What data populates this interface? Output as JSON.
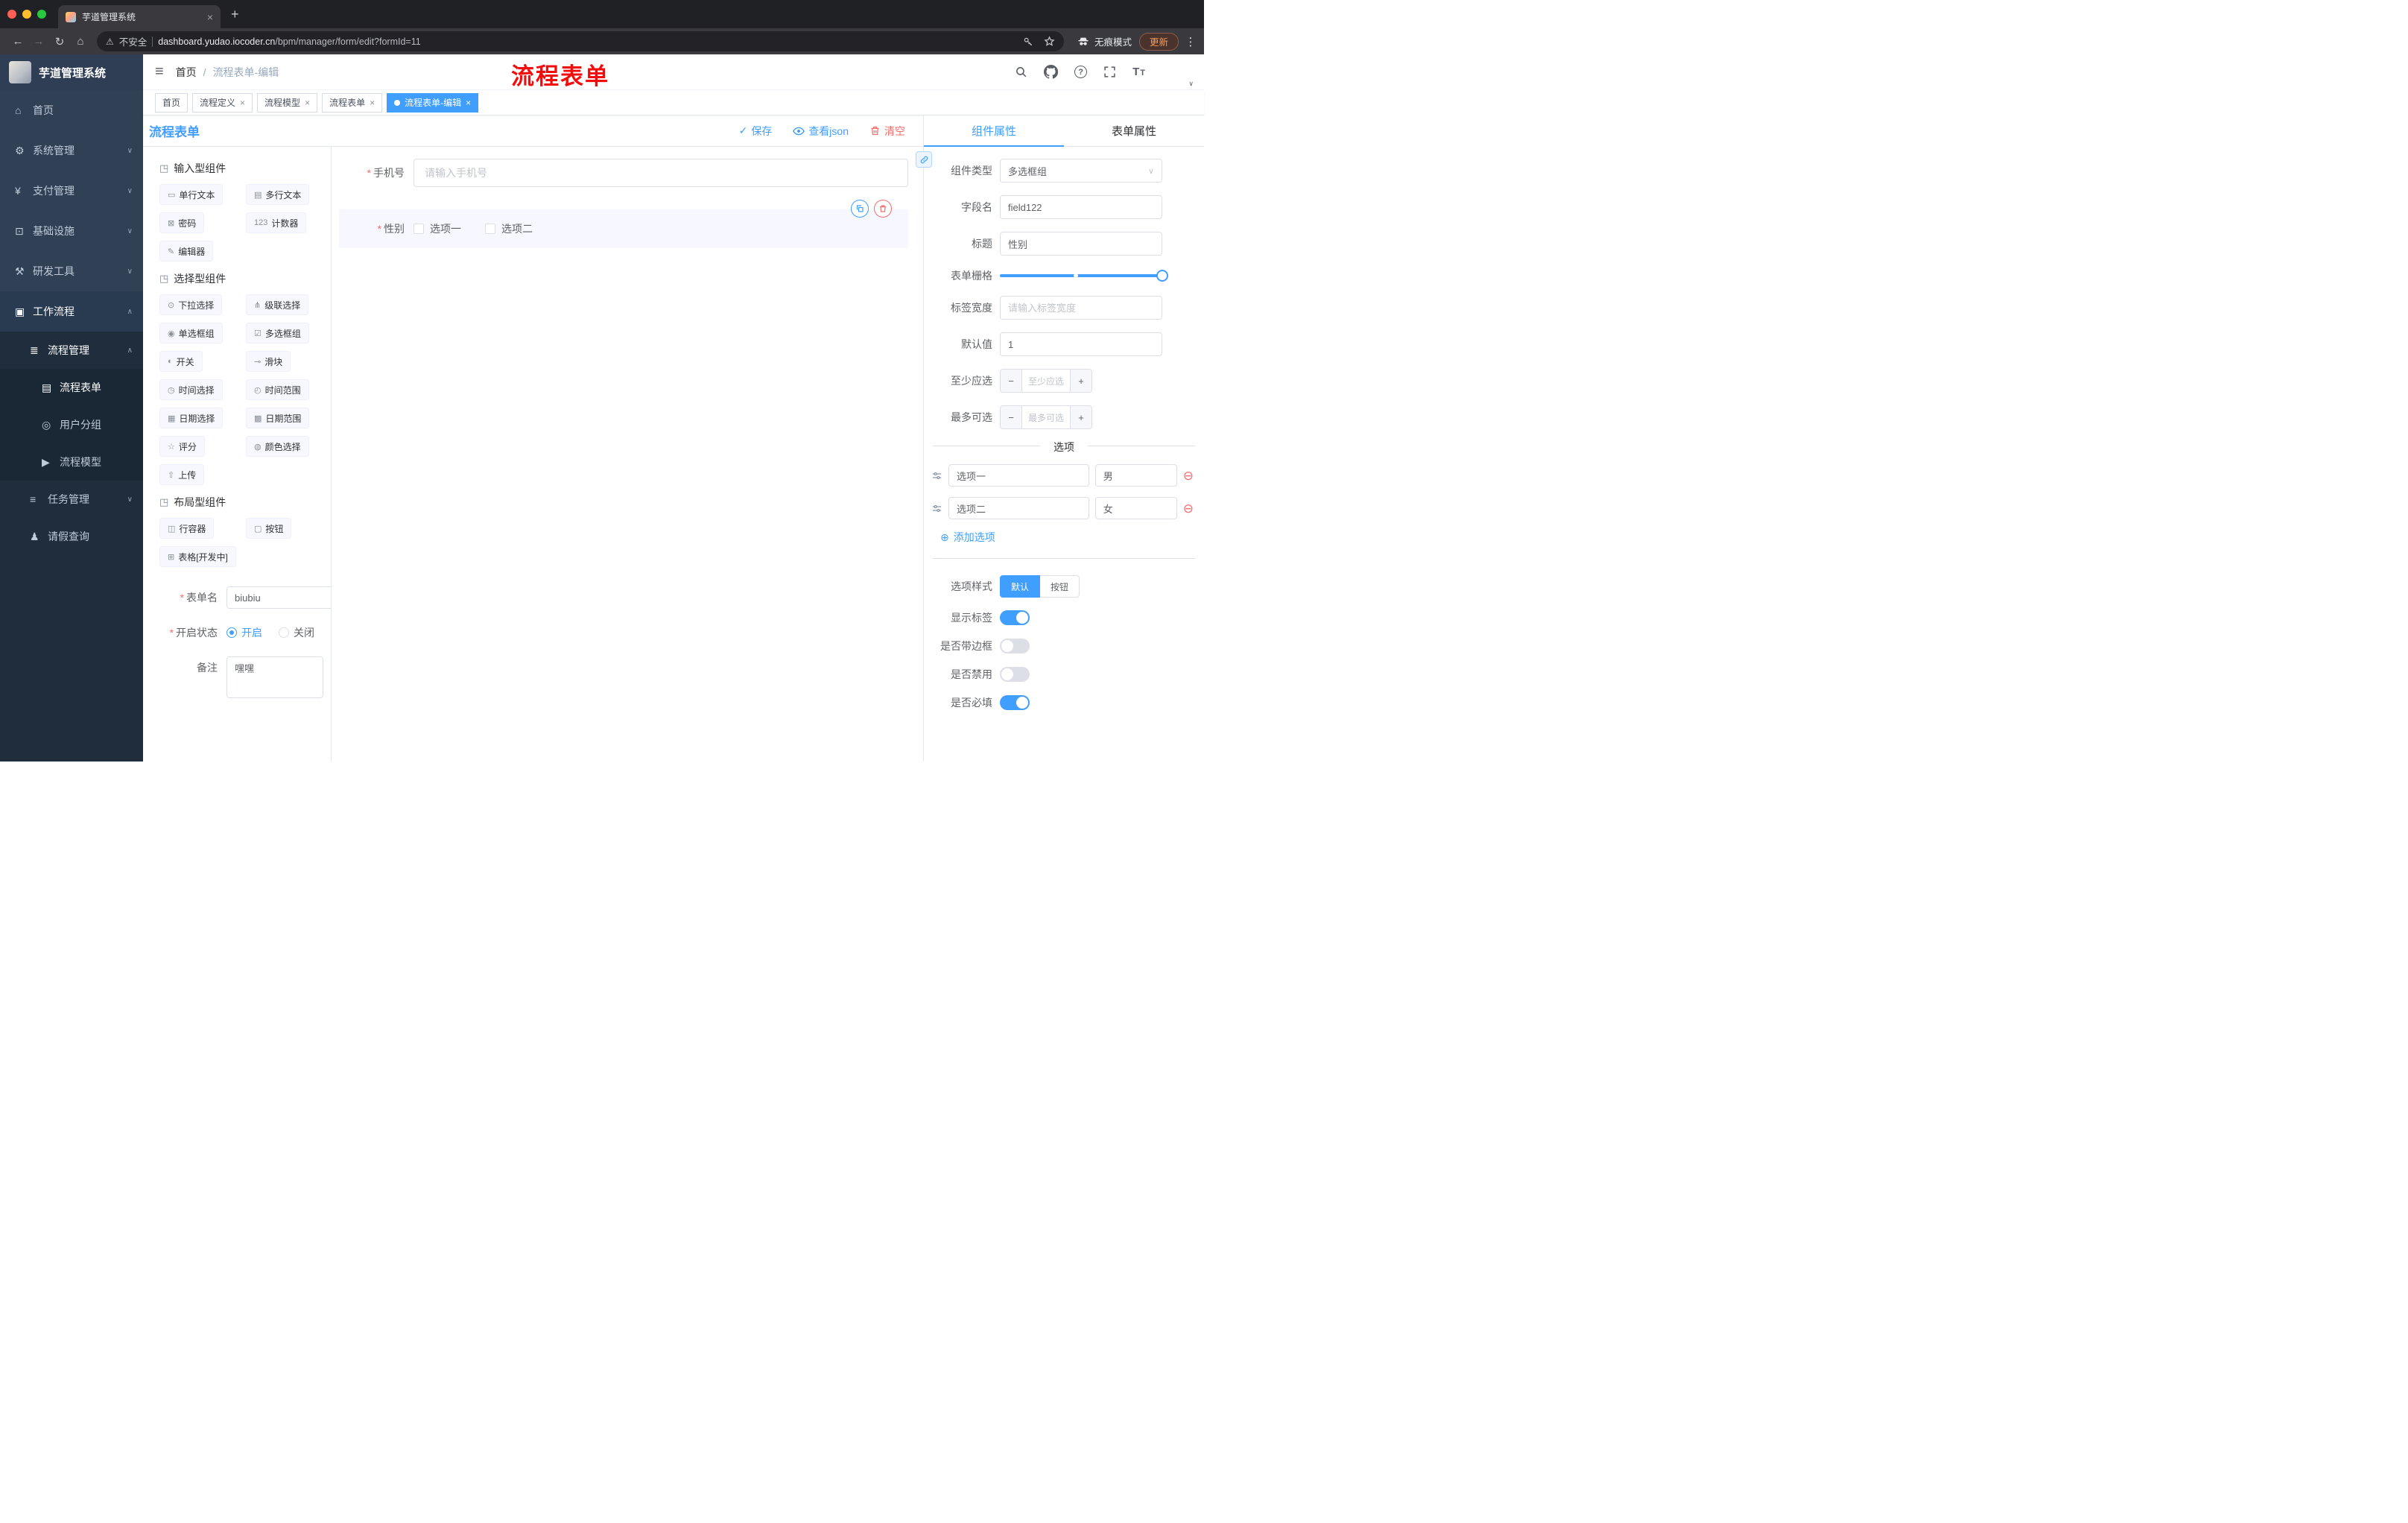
{
  "icons": {
    "back": "←",
    "forward": "→",
    "reload": "↻",
    "home": "⌂",
    "warning": "⚠",
    "dots": "⋮",
    "new_tab": "+",
    "close": "×",
    "hamburger": "≡",
    "required": "*",
    "check": "✓",
    "minus": "−",
    "plus": "+",
    "add_circle": "⊕",
    "remove_circle": "⊖",
    "caret_down": "∨",
    "counter": "123"
  },
  "browser": {
    "tab_title": "芋道管理系统",
    "security": "不安全",
    "url_domain": "dashboard.yudao.iocoder.cn",
    "url_path": "/bpm/manager/form/edit?formId=11",
    "incognito": "无痕模式",
    "update": "更新"
  },
  "sidebar": {
    "logo": "芋道管理系统",
    "items": [
      {
        "icon": "⌂",
        "label": "首页",
        "chevron": ""
      },
      {
        "icon": "⚙",
        "label": "系统管理",
        "chevron": "∨"
      },
      {
        "icon": "¥",
        "label": "支付管理",
        "chevron": "∨"
      },
      {
        "icon": "⊡",
        "label": "基础设施",
        "chevron": "∨"
      },
      {
        "icon": "⚒",
        "label": "研发工具",
        "chevron": "∨"
      },
      {
        "icon": "▣",
        "label": "工作流程",
        "chevron": "∧"
      },
      {
        "icon": "≣",
        "label": "流程管理",
        "chevron": "∧"
      },
      {
        "icon": "▤",
        "label": "流程表单",
        "chevron": ""
      },
      {
        "icon": "◎",
        "label": "用户分组",
        "chevron": ""
      },
      {
        "icon": "▶",
        "label": "流程模型",
        "chevron": ""
      },
      {
        "icon": "≡",
        "label": "任务管理",
        "chevron": "∨"
      },
      {
        "icon": "♟",
        "label": "请假查询",
        "chevron": ""
      }
    ]
  },
  "header": {
    "breadcrumb_home": "首页",
    "breadcrumb_sep": "/",
    "breadcrumb_current": "流程表单-编辑",
    "annotation": "流程表单",
    "font_icon_big": "T",
    "font_icon_small": "T",
    "help_mark": "?"
  },
  "tags": [
    {
      "label": "首页"
    },
    {
      "label": "流程定义"
    },
    {
      "label": "流程模型"
    },
    {
      "label": "流程表单"
    },
    {
      "label": "流程表单-编辑"
    }
  ],
  "designer": {
    "title": "流程表单",
    "save": "保存",
    "view_json": "查看json",
    "clear": "清空",
    "groups": [
      {
        "icon": "◳",
        "title": "输入型组件",
        "items": [
          {
            "icon": "▭",
            "label": "单行文本"
          },
          {
            "icon": "▤",
            "label": "多行文本"
          },
          {
            "icon": "⊠",
            "label": "密码"
          },
          {
            "icon": "123",
            "label": "计数器"
          },
          {
            "icon": "✎",
            "label": "编辑器"
          }
        ]
      },
      {
        "icon": "◳",
        "title": "选择型组件",
        "items": [
          {
            "icon": "⊙",
            "label": "下拉选择"
          },
          {
            "icon": "⋔",
            "label": "级联选择"
          },
          {
            "icon": "◉",
            "label": "单选框组"
          },
          {
            "icon": "☑",
            "label": "多选框组"
          },
          {
            "icon": "◐",
            "label": "开关"
          },
          {
            "icon": "⊸",
            "label": "滑块"
          },
          {
            "icon": "◷",
            "label": "时间选择"
          },
          {
            "icon": "◴",
            "label": "时间范围"
          },
          {
            "icon": "▦",
            "label": "日期选择"
          },
          {
            "icon": "▩",
            "label": "日期范围"
          },
          {
            "icon": "☆",
            "label": "评分"
          },
          {
            "icon": "◍",
            "label": "颜色选择"
          },
          {
            "icon": "⇧",
            "label": "上传"
          }
        ]
      },
      {
        "icon": "◳",
        "title": "布局型组件",
        "items": [
          {
            "icon": "◫",
            "label": "行容器"
          },
          {
            "icon": "▢",
            "label": "按钮"
          },
          {
            "icon": "⊞",
            "label": "表格[开发中]"
          }
        ]
      }
    ],
    "form": {
      "name_label": "表单名",
      "name_value": "biubiu",
      "status_label": "开启状态",
      "status_on": "开启",
      "status_off": "关闭",
      "remark_label": "备注",
      "remark_value": "嘿嘿"
    }
  },
  "canvas": {
    "phone_label": "手机号",
    "phone_placeholder": "请输入手机号",
    "gender_label": "性别",
    "gender_options": [
      {
        "label": "选项一"
      },
      {
        "label": "选项二"
      }
    ]
  },
  "props": {
    "tab_component": "组件属性",
    "tab_form": "表单属性",
    "type_label": "组件类型",
    "type_value": "多选框组",
    "field_label": "字段名",
    "field_value": "field122",
    "title_label": "标题",
    "title_value": "性别",
    "grid_label": "表单栅格",
    "label_width_label": "标签宽度",
    "label_width_placeholder": "请输入标签宽度",
    "default_label": "默认值",
    "default_value": "1",
    "min_label": "至少应选",
    "min_placeholder": "至少应选",
    "max_label": "最多可选",
    "max_placeholder": "最多可选",
    "options_divider": "选项",
    "options": [
      {
        "label": "选项一",
        "value": "男"
      },
      {
        "label": "选项二",
        "value": "女"
      }
    ],
    "add_option": "添加选项",
    "style_label": "选项样式",
    "style_default": "默认",
    "style_button": "按钮",
    "switches": [
      {
        "label": "显示标签"
      },
      {
        "label": "是否带边框"
      },
      {
        "label": "是否禁用"
      },
      {
        "label": "是否必填"
      }
    ]
  }
}
